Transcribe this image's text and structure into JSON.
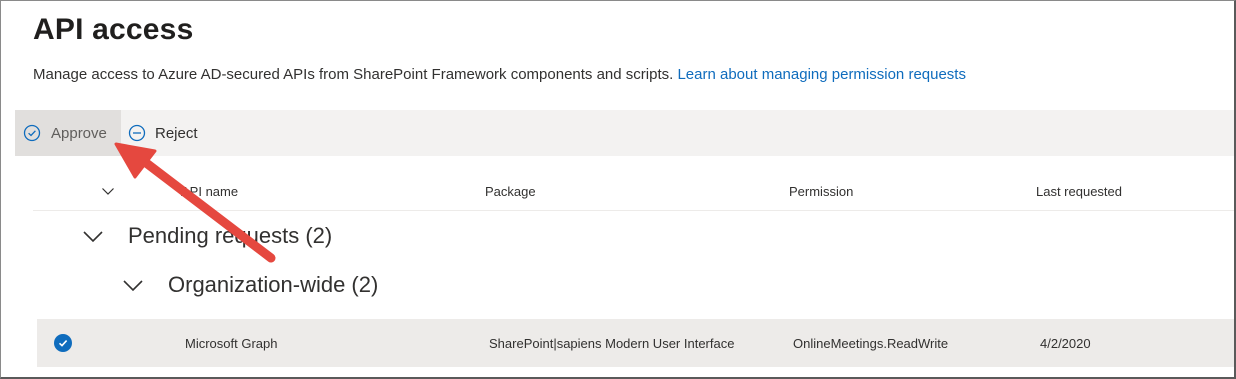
{
  "page": {
    "title": "API access",
    "description": "Manage access to Azure AD-secured APIs from SharePoint Framework components and scripts.",
    "learn_link": "Learn about managing permission requests"
  },
  "toolbar": {
    "approve_label": "Approve",
    "reject_label": "Reject"
  },
  "table": {
    "columns": [
      "API name",
      "Package",
      "Permission",
      "Last requested"
    ],
    "groups": [
      {
        "label": "Pending requests (2)"
      },
      {
        "label": "Organization-wide (2)"
      }
    ],
    "rows": [
      {
        "api_name": "Microsoft Graph",
        "package": "SharePoint|sapiens Modern User Interface",
        "permission": "OnlineMeetings.ReadWrite",
        "last_requested": "4/2/2020",
        "selected": true
      }
    ]
  },
  "colors": {
    "accent": "#0f6cbd",
    "toolbar_bg": "#f3f2f1",
    "selected_row_bg": "#edebe9",
    "annotation_arrow": "#e5483f"
  },
  "icons": {
    "approve": "check-circle-icon",
    "reject": "minus-circle-icon",
    "expand": "chevron-down-icon",
    "row_check": "checkmark-icon"
  }
}
